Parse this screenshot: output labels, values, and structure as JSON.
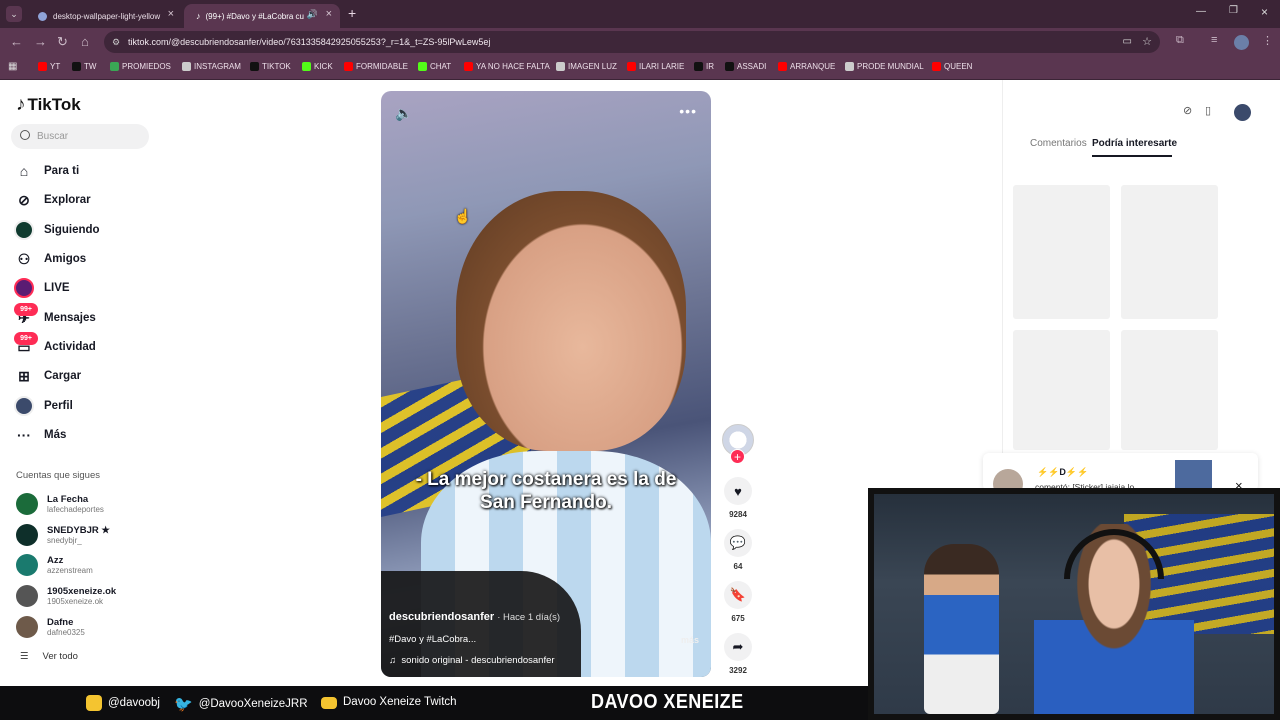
{
  "browser": {
    "tabs": [
      {
        "title": "desktop-wallpaper-light-yellow",
        "active": false
      },
      {
        "title": "(99+) #Davo y #LaCobra cu",
        "active": true
      }
    ],
    "url": "tiktok.com/@descubriendosanfer/video/7631335842925055253?_r=1&_t=ZS-95lPwLew5ej",
    "bookmarks": [
      {
        "label": "YT",
        "icon": "youtube-icon",
        "color": "#ff0000"
      },
      {
        "label": "TW",
        "icon": "x-icon",
        "color": "#111111"
      },
      {
        "label": "PROMIEDOS",
        "icon": "promiedos-icon",
        "color": "#3aa655"
      },
      {
        "label": "INSTAGRAM",
        "icon": "globe-icon",
        "color": "#cccccc"
      },
      {
        "label": "TIKTOK",
        "icon": "tiktok-icon",
        "color": "#111111"
      },
      {
        "label": "KICK",
        "icon": "kick-icon",
        "color": "#53fc18"
      },
      {
        "label": "FORMIDABLE",
        "icon": "youtube-icon",
        "color": "#ff0000"
      },
      {
        "label": "CHAT",
        "icon": "kick-icon",
        "color": "#53fc18"
      },
      {
        "label": "YA NO HACE FALTA",
        "icon": "youtube-icon",
        "color": "#ff0000"
      },
      {
        "label": "IMAGEN LUZ",
        "icon": "globe-icon",
        "color": "#cccccc"
      },
      {
        "label": "ILARI LARIE",
        "icon": "youtube-icon",
        "color": "#ff0000"
      },
      {
        "label": "IR",
        "icon": "mk-icon",
        "color": "#111111"
      },
      {
        "label": "ASSADI",
        "icon": "x-icon",
        "color": "#111111"
      },
      {
        "label": "ARRANQUE",
        "icon": "youtube-icon",
        "color": "#ff0000"
      },
      {
        "label": "PRODE MUNDIAL",
        "icon": "globe-icon",
        "color": "#cccccc"
      },
      {
        "label": "QUEEN",
        "icon": "youtube-icon",
        "color": "#ff0000"
      }
    ]
  },
  "tiktok": {
    "logo": "TikTok",
    "search_placeholder": "Buscar",
    "nav": [
      {
        "label": "Para ti",
        "icon": "home-icon"
      },
      {
        "label": "Explorar",
        "icon": "compass-icon"
      },
      {
        "label": "Siguiendo",
        "icon": "following-avatar-icon"
      },
      {
        "label": "Amigos",
        "icon": "friends-icon"
      },
      {
        "label": "LIVE",
        "icon": "live-icon"
      },
      {
        "label": "Mensajes",
        "icon": "messages-icon",
        "badge": "99+"
      },
      {
        "label": "Actividad",
        "icon": "activity-icon",
        "badge": "99+"
      },
      {
        "label": "Cargar",
        "icon": "upload-icon"
      },
      {
        "label": "Perfil",
        "icon": "profile-avatar-icon"
      },
      {
        "label": "Más",
        "icon": "more-icon"
      }
    ],
    "following_title": "Cuentas que sigues",
    "following": [
      {
        "name": "La Fecha",
        "handle": "lafechadeportes",
        "color": "#1b6b3a"
      },
      {
        "name": "SNEDYBJR ★",
        "handle": "snedybjr_",
        "color": "#0e2f2a"
      },
      {
        "name": "Azz",
        "handle": "azzenstream",
        "color": "#1a7a6e"
      },
      {
        "name": "1905xeneize.ok",
        "handle": "1905xeneize.ok",
        "color": "#555555"
      },
      {
        "name": "Dafne",
        "handle": "dafne0325",
        "color": "#6e5a4a"
      }
    ],
    "see_all": "Ver todo"
  },
  "video": {
    "subtitle": "- La mejor costanera es la de San Fernando.",
    "author": "descubriendosanfer",
    "time": "· Hace 1 día(s)",
    "tags": "#Davo y #LaCobra...",
    "more": "más",
    "sound": "sonido original - descubriendosanfer"
  },
  "actions": {
    "likes": "9284",
    "comments": "64",
    "saves": "675",
    "shares": "3292"
  },
  "right_panel": {
    "tab_comments": "Comentarios",
    "tab_interest": "Podría interesarte",
    "notification": {
      "name": "D",
      "text": "comentó: [Sticker] jajaja lo"
    }
  },
  "banner": {
    "instagram": "@davoobj",
    "twitter": "@DavooXeneizeJRR",
    "twitch": "Davoo Xeneize Twitch",
    "brand": "DAVOO XENEIZE"
  }
}
